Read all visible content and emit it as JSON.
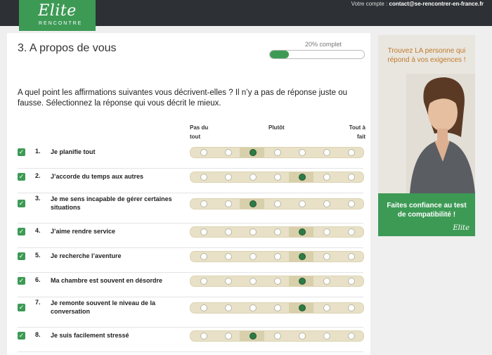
{
  "header": {
    "logo_text": "Elite",
    "logo_sub": "RENCONTRE",
    "account_label": "Votre compte :",
    "account_email": "contact@se-rencontrer-en-france.fr"
  },
  "section": {
    "title": "3. A propos de vous",
    "progress_label": "20% complet",
    "progress_fraction": 0.2,
    "intro": "A quel point les affirmations suivantes vous décrivent-elles ? Il n’y a pas de réponse juste ou fausse. Sélectionnez la réponse qui vous décrit le mieux."
  },
  "scale": {
    "left": "Pas du tout",
    "middle": "Plutôt",
    "right": "Tout à fait"
  },
  "questions": [
    {
      "num": "1.",
      "text": "Je planifie tout",
      "selected": 3
    },
    {
      "num": "2.",
      "text": "J’accorde du temps aux autres",
      "selected": 5
    },
    {
      "num": "3.",
      "text": "Je me sens incapable de gérer certaines situations",
      "selected": 3
    },
    {
      "num": "4.",
      "text": "J’aime rendre service",
      "selected": 5
    },
    {
      "num": "5.",
      "text": "Je recherche l’aventure",
      "selected": 5
    },
    {
      "num": "6.",
      "text": "Ma chambre est souvent en désordre",
      "selected": 5
    },
    {
      "num": "7.",
      "text": "Je remonte souvent le niveau de la conversation",
      "selected": 5
    },
    {
      "num": "8.",
      "text": "Je suis facilement stressé",
      "selected": 3
    }
  ],
  "ad": {
    "headline": "Trouvez LA personne qui répond à vos exigences !",
    "tagline": "Faites confiance au test de compatibilité !",
    "logo": "Elite"
  },
  "colors": {
    "brand_green": "#3d9a55",
    "topbar": "#2d3035",
    "accent_orange": "#c17a2d"
  }
}
